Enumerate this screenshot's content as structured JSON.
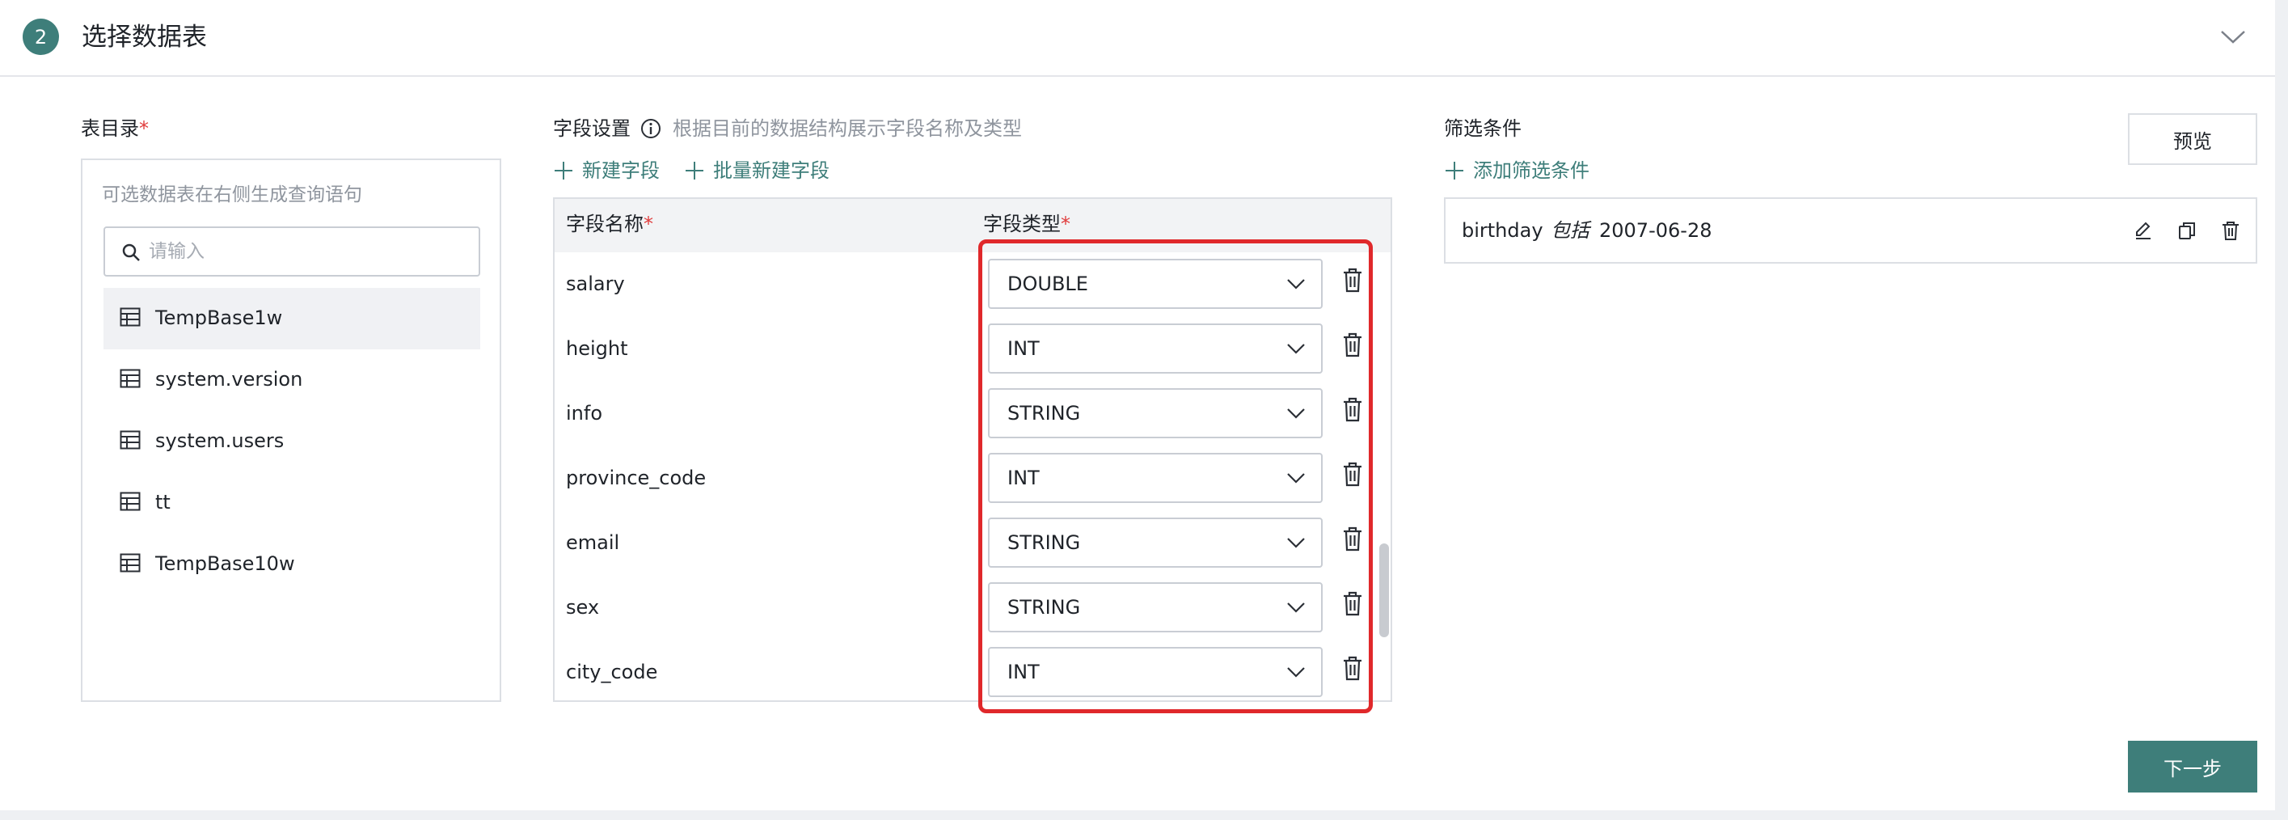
{
  "header": {
    "step_number": "2",
    "title": "选择数据表"
  },
  "catalog": {
    "label": "表目录",
    "required_mark": "*",
    "hint": "可选数据表在右侧生成查询语句",
    "search_placeholder": "请输入",
    "tables": [
      "TempBase1w",
      "system.version",
      "system.users",
      "tt",
      "TempBase10w"
    ],
    "active_index": 0
  },
  "fields": {
    "label": "字段设置",
    "hint": "根据目前的数据结构展示字段名称及类型",
    "new_field": "新建字段",
    "batch_new_field": "批量新建字段",
    "col_name": "字段名称",
    "col_type": "字段类型",
    "required_mark": "*",
    "rows": [
      {
        "name": "salary",
        "type": "DOUBLE"
      },
      {
        "name": "height",
        "type": "INT"
      },
      {
        "name": "info",
        "type": "STRING"
      },
      {
        "name": "province_code",
        "type": "INT"
      },
      {
        "name": "email",
        "type": "STRING"
      },
      {
        "name": "sex",
        "type": "STRING"
      },
      {
        "name": "city_code",
        "type": "INT"
      }
    ]
  },
  "filter": {
    "label": "筛选条件",
    "add_condition": "添加筛选条件",
    "preview": "预览",
    "conditions": [
      {
        "field": "birthday",
        "op": "包括",
        "value": "2007-06-28"
      }
    ]
  },
  "footer": {
    "next": "下一步"
  },
  "colors": {
    "accent": "#3e7e7a",
    "required": "#e03c3c",
    "highlight": "#e0282b"
  }
}
